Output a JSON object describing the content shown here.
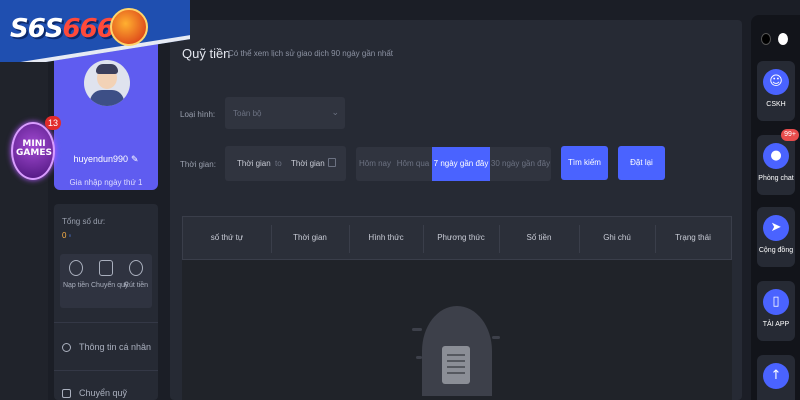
{
  "logo": {
    "text_main": "S6S",
    "text_accent": "666"
  },
  "mini_games": {
    "label": "MINI GAMES",
    "count": "13"
  },
  "user": {
    "username": "huyendun990",
    "edit_icon": "pencil-icon",
    "login_note": "Gia nhập ngày thứ 1"
  },
  "wallet": {
    "balance_label": "Tổng số dư:",
    "balance_value": "0",
    "actions": [
      {
        "label": "Nạp tiền",
        "icon": "deposit-icon"
      },
      {
        "label": "Chuyển quỹ",
        "icon": "transfer-icon"
      },
      {
        "label": "Rút tiền",
        "icon": "withdraw-icon"
      }
    ]
  },
  "side_menu": {
    "items": [
      {
        "label": "Thông tin cá nhân",
        "icon": "user-info-icon"
      },
      {
        "label": "Chuyển quỹ",
        "icon": "transfer-icon"
      }
    ]
  },
  "main": {
    "title": "Quỹ tiền",
    "subtitle": "Có thể xem lịch sử giao dịch 90 ngày gần nhất",
    "type_label": "Loại hình:",
    "type_value": "Toàn bộ",
    "time_label": "Thời gian:",
    "date_from": "Thời gian",
    "date_sep": "to",
    "date_to": "Thời gian",
    "quick_ranges": [
      "Hôm nay",
      "Hôm qua",
      "7 ngày gần đây",
      "30 ngày gần đây"
    ],
    "selected_range": "7 ngày gần đây",
    "search_button": "Tìm kiếm",
    "reset_button": "Đặt lại",
    "table_headers": [
      "số thứ tự",
      "Thời gian",
      "Hình thức",
      "Phương thức",
      "Số tiền",
      "Ghi chú",
      "Trạng thái"
    ]
  },
  "right_rail": {
    "items": [
      {
        "label": "CSKH",
        "icon": "support-icon",
        "badge": ""
      },
      {
        "label": "Phòng chat",
        "icon": "chat-icon",
        "badge": "99+"
      },
      {
        "label": "Cộng đồng",
        "icon": "telegram-icon",
        "badge": ""
      },
      {
        "label": "TẢI APP",
        "icon": "download-app-icon",
        "badge": ""
      }
    ]
  },
  "colors": {
    "accent": "#4a63ff",
    "user_card": "#5f5cf0",
    "background": "#1b1e26",
    "badge": "#e84c4c"
  }
}
